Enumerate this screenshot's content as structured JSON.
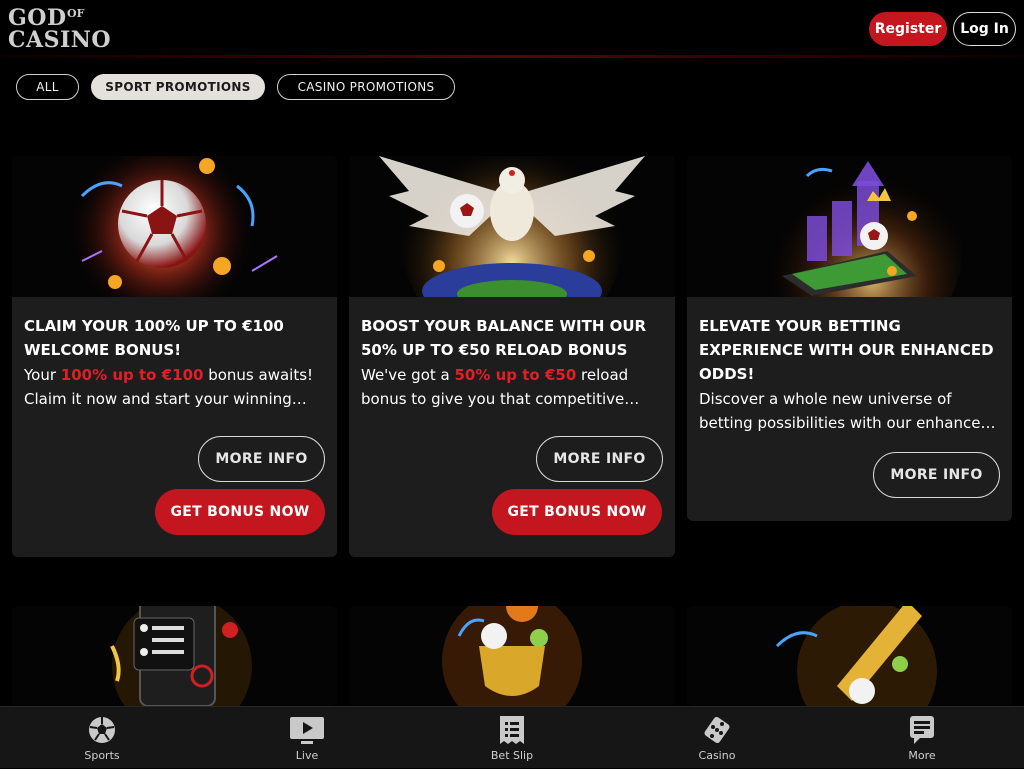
{
  "header": {
    "logo_line1": "GOD",
    "logo_of": "OF",
    "logo_line2": "CASINO",
    "register_label": "Register",
    "login_label": "Log In"
  },
  "filters": [
    {
      "label": "ALL",
      "active": false
    },
    {
      "label": "SPORT PROMOTIONS",
      "active": true
    },
    {
      "label": "CASINO PROMOTIONS",
      "active": false
    }
  ],
  "promotions": [
    {
      "title": "CLAIM YOUR 100% UP TO €100 WELCOME BONUS!",
      "desc_pre": "Your ",
      "desc_highlight": "100% up to €100",
      "desc_post": " bonus awaits! Claim it now and start your winning journey.",
      "more_label": "MORE INFO",
      "bonus_label": "GET BONUS NOW"
    },
    {
      "title": "BOOST YOUR BALANCE WITH OUR 50% UP TO €50 RELOAD BONUS",
      "desc_pre": "We've got a ",
      "desc_highlight": "50% up to €50",
      "desc_post": " reload bonus to give you that competitive edge.",
      "more_label": "MORE INFO",
      "bonus_label": "GET BONUS NOW"
    },
    {
      "title": "ELEVATE YOUR BETTING EXPERIENCE WITH OUR ENHANCED ODDS!",
      "desc_pre": "Discover a whole new universe of betting possibilities with our enhanced odds.",
      "desc_highlight": "",
      "desc_post": "",
      "more_label": "MORE INFO"
    }
  ],
  "bottom_nav": [
    {
      "label": "Sports",
      "icon": "soccer-ball-icon"
    },
    {
      "label": "Live",
      "icon": "play-screen-icon"
    },
    {
      "label": "Bet Slip",
      "icon": "receipt-icon"
    },
    {
      "label": "Casino",
      "icon": "dice-icon"
    },
    {
      "label": "More",
      "icon": "more-menu-icon"
    }
  ],
  "colors": {
    "accent_red": "#c3161f",
    "highlight_red": "#e11f26",
    "card_bg": "#1d1d1d",
    "page_bg": "#000000"
  }
}
